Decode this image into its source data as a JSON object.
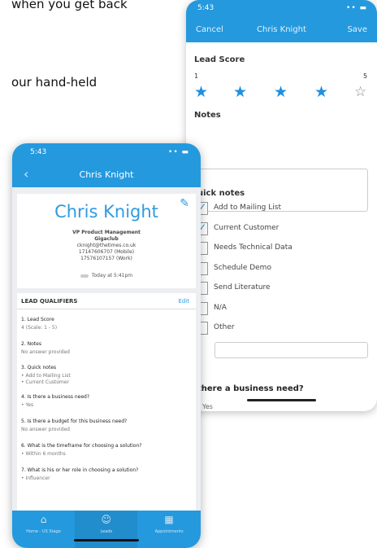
{
  "background": {
    "line1": "when you get back",
    "line2": "our hand-held"
  },
  "back_phone": {
    "status_time": "5:43",
    "status_icons": "•• ▬",
    "nav": {
      "cancel": "Cancel",
      "title": "Chris Knight",
      "save": "Save"
    },
    "lead_score": {
      "label": "Lead Score",
      "min": "1",
      "max": "5",
      "rating": 4,
      "max_rating": 5
    },
    "notes_label": "Notes",
    "quick_notes": {
      "label": "uick notes",
      "items": [
        {
          "label": "Add to Mailing List",
          "checked": true
        },
        {
          "label": "Current Customer",
          "checked": true
        },
        {
          "label": "Needs Technical Data",
          "checked": false
        },
        {
          "label": "Schedule Demo",
          "checked": false
        },
        {
          "label": "Send Literature",
          "checked": false
        },
        {
          "label": "N/A",
          "checked": false
        },
        {
          "label": "Other",
          "checked": false
        }
      ]
    },
    "business_need_question": "there a business need?",
    "partial_option": "Yes"
  },
  "front_phone": {
    "status_time": "5:43",
    "status_icons": "•• ▬",
    "nav_title": "Chris Knight",
    "contact": {
      "name": "Chris Knight",
      "title": "VP Product Management",
      "company": "Gigaclub",
      "email": "cknight@thetimes.co.uk",
      "mobile": "17147606707 (Mobile)",
      "work": "17576107157 (Work)",
      "timestamp": "Today at 5:41pm"
    },
    "qualifiers": {
      "header": "LEAD QUALIFIERS",
      "edit": "Edit",
      "items": [
        {
          "q": "1. Lead Score",
          "a": "4 (Scale: 1 - 5)"
        },
        {
          "q": "2. Notes",
          "a": "No answer provided"
        },
        {
          "q": "3. Quick notes",
          "a": "• Add to Mailing List",
          "a2": "• Current Customer"
        },
        {
          "q": "4. Is there a business need?",
          "a": "• Yes"
        },
        {
          "q": "5. Is there a budget for this business need?",
          "a": "No answer provided"
        },
        {
          "q": "6. What is the timeframe for choosing a solution?",
          "a": "• Within 6 months"
        },
        {
          "q": "7. What is his or her role in choosing a solution?",
          "a": "• Influencer"
        }
      ]
    },
    "tabs": [
      {
        "label": "Home - US Stage",
        "icon": "home-icon"
      },
      {
        "label": "Leads",
        "icon": "people-icon"
      },
      {
        "label": "Appointments",
        "icon": "calendar-icon"
      }
    ]
  }
}
